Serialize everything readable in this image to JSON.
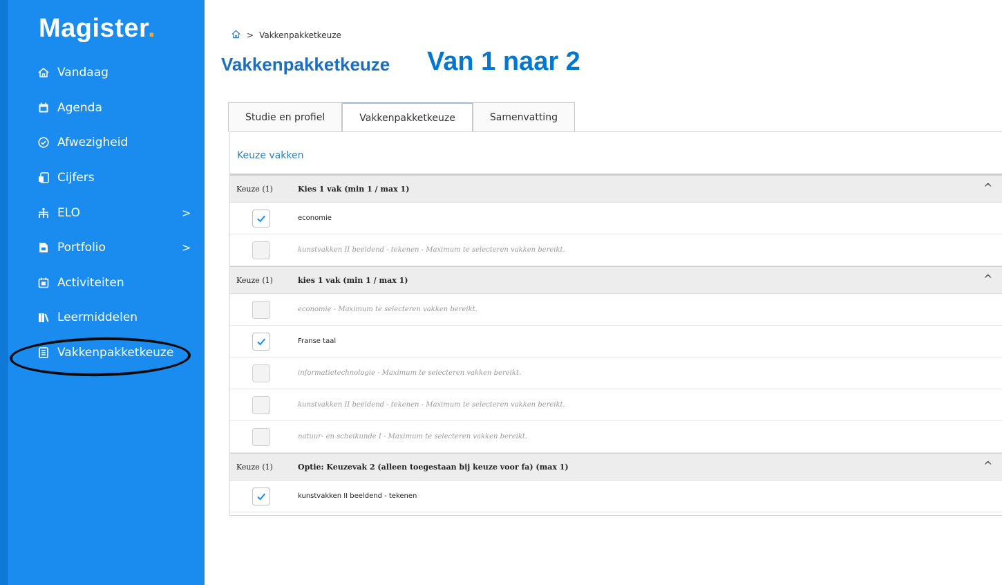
{
  "sidebar": {
    "logo": "Magister",
    "logo_dot": ".",
    "items": [
      {
        "label": "Vandaag",
        "icon": "home-icon",
        "chevron": false
      },
      {
        "label": "Agenda",
        "icon": "calendar-icon",
        "chevron": false
      },
      {
        "label": "Afwezigheid",
        "icon": "check-circle-icon",
        "chevron": false
      },
      {
        "label": "Cijfers",
        "icon": "grades-icon",
        "chevron": false
      },
      {
        "label": "ELO",
        "icon": "elo-icon",
        "chevron": true
      },
      {
        "label": "Portfolio",
        "icon": "portfolio-icon",
        "chevron": true
      },
      {
        "label": "Activiteiten",
        "icon": "activities-icon",
        "chevron": false
      },
      {
        "label": "Leermiddelen",
        "icon": "books-icon",
        "chevron": false
      },
      {
        "label": "Vakkenpakketkeuze",
        "icon": "list-icon",
        "chevron": false,
        "active": true
      }
    ],
    "chevron_glyph": ">"
  },
  "breadcrumb": {
    "separator": ">",
    "current": "Vakkenpakketkeuze"
  },
  "page_title": "Vakkenpakketkeuze",
  "overlay_caption": "Van 1 naar 2",
  "tabs": [
    {
      "label": "Studie en profiel",
      "active": false
    },
    {
      "label": "Vakkenpakketkeuze",
      "active": true
    },
    {
      "label": "Samenvatting",
      "active": false
    }
  ],
  "panel": {
    "label": "Keuze vakken",
    "groups": [
      {
        "keuze": "Keuze (1)",
        "title": "Kies 1 vak (min 1 / max 1)",
        "caret": "^",
        "rows": [
          {
            "text": "economie",
            "checked": true,
            "disabled": false
          },
          {
            "text": "kunstvakken II beeldend - tekenen - Maximum te selecteren vakken bereikt.",
            "checked": false,
            "disabled": true
          }
        ]
      },
      {
        "keuze": "Keuze (1)",
        "title": "kies 1 vak (min 1 / max 1)",
        "caret": "^",
        "rows": [
          {
            "text": "economie - Maximum te selecteren vakken bereikt.",
            "checked": false,
            "disabled": true
          },
          {
            "text": "Franse taal",
            "checked": true,
            "disabled": false
          },
          {
            "text": "informatietechnologie - Maximum te selecteren vakken bereikt.",
            "checked": false,
            "disabled": true
          },
          {
            "text": "kunstvakken II beeldend - tekenen - Maximum te selecteren vakken bereikt.",
            "checked": false,
            "disabled": true
          },
          {
            "text": "natuur- en scheikunde I - Maximum te selecteren vakken bereikt.",
            "checked": false,
            "disabled": true
          }
        ]
      },
      {
        "keuze": "Keuze (1)",
        "title": "Optie: Keuzevak 2 (alleen toegestaan bij keuze voor fa) (max 1)",
        "caret": "^",
        "rows": [
          {
            "text": "kunstvakken II beeldend - tekenen",
            "checked": true,
            "disabled": false
          }
        ]
      }
    ]
  },
  "colors": {
    "sidebar": "#1a8cf0",
    "title": "#1a6fc0",
    "caption": "#0077d4",
    "check": "#1a8cf0"
  }
}
